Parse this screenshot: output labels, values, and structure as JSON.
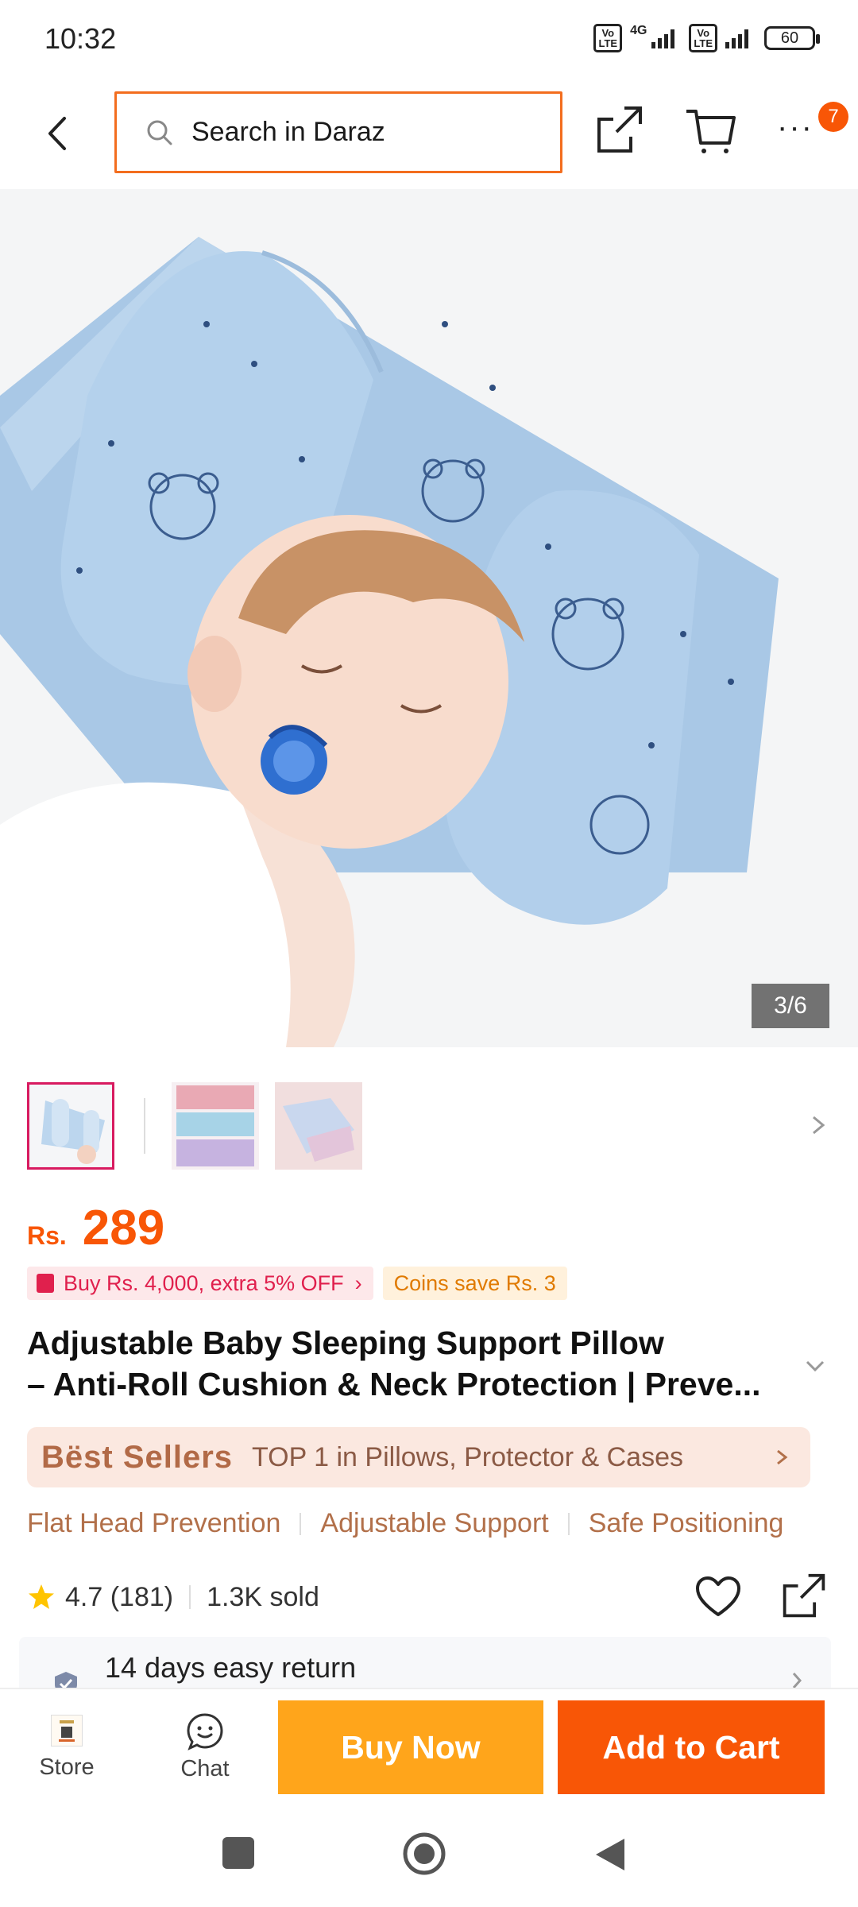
{
  "status_bar": {
    "time": "10:32",
    "sim1_label": "Vo LTE",
    "sim1_network": "4G",
    "sim2_label": "Vo LTE",
    "battery": "60"
  },
  "header": {
    "search_placeholder": "Search in Daraz",
    "more_badge": "7",
    "icons": [
      "back-arrow-icon",
      "search-icon",
      "share-icon",
      "cart-icon",
      "more-dots-icon"
    ]
  },
  "gallery": {
    "counter": "3/6",
    "thumbnail_count": 3
  },
  "product": {
    "price_currency": "Rs.",
    "price_amount": "289",
    "promo_voucher": "Buy Rs. 4,000, extra 5% OFF",
    "promo_coins": "Coins save Rs. 3",
    "title_line1": "Adjustable Baby Sleeping Support Pillow",
    "title_line2": "– Anti-Roll Cushion & Neck Protection | Preve...",
    "best_sellers_label": "Bëst Sellers",
    "best_sellers_text": "TOP 1 in Pillows, Protector & Cases",
    "features": [
      "Flat Head Prevention",
      "Adjustable Support",
      "Safe Positioning"
    ],
    "rating": "4.7 (181)",
    "sold": "1.3K sold",
    "return_policy": "14 days easy return"
  },
  "actions": {
    "store_label": "Store",
    "chat_label": "Chat",
    "buy_now_label": "Buy Now",
    "add_to_cart_label": "Add to Cart"
  },
  "colors": {
    "brand_orange": "#f85606",
    "buy_now": "#ffa51b",
    "search_border": "#f36d1e",
    "promo_pink": "#e0204d",
    "best_sellers_bg": "#fbe8e0"
  }
}
